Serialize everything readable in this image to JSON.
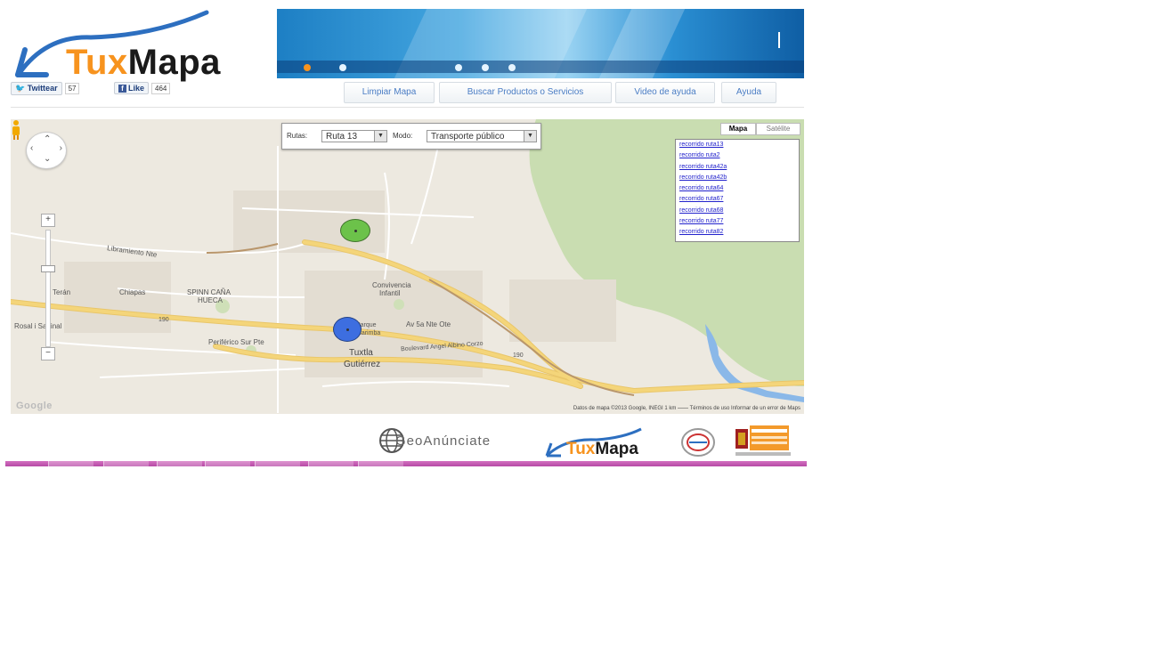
{
  "header": {
    "logo_part1": "Tux",
    "logo_part2": "Mapa",
    "twitter_label": "Twittear",
    "twitter_count": "57",
    "facebook_label": "Like",
    "facebook_count": "464"
  },
  "nav": {
    "items": [
      {
        "label": "Limpiar Mapa"
      },
      {
        "label": "Buscar Productos o Servicios"
      },
      {
        "label": "Video de ayuda"
      },
      {
        "label": "Ayuda"
      }
    ]
  },
  "map": {
    "route_label": "Rutas:",
    "route_value": "Ruta 13",
    "mode_label": "Modo:",
    "mode_value": "Transporte público",
    "maptype": {
      "map": "Mapa",
      "satellite": "Satélite"
    },
    "routes": [
      "recorrido ruta13",
      "recorrido ruta2",
      "recorrido ruta42a",
      "recorrido ruta42b",
      "recorrido ruta64",
      "recorrido ruta67",
      "recorrido ruta68",
      "recorrido ruta77",
      "recorrido ruta82"
    ],
    "places": {
      "city": "Tuxtla",
      "city2": "Gutiérrez",
      "convivencia": "Convivencia",
      "convivencia2": "Infantil",
      "spinn": "SPINN CAÑA",
      "spinn2": "HUECA",
      "libramiento": "Libramiento Nte",
      "chiapas": "Chiapas",
      "av_sur": "Periférico Sur Pte",
      "av_norte": "Av 5a Nte Ote",
      "hwy": "190",
      "hwy2": "190",
      "terán": "Terán",
      "rosal": "Rosal i Sabinal",
      "blvd": "Boulevard Angel Albino Corzo",
      "parque": "Parque",
      "parque2": "Marimba"
    },
    "google": "Google",
    "attribution": "Datos de mapa ©2013 Google, INEGI   1 km ⎯⎯⎯⎯   Términos de uso   Informar de un error de Maps"
  },
  "footer": {
    "geo_label": "GeoAnúnciate",
    "tux_part1": "Tux",
    "tux_part2": "Mapa"
  },
  "colors": {
    "accent_orange": "#f7931e",
    "link_blue": "#4a7dc4",
    "marker_green": "#6cc24a",
    "marker_blue": "#3d6ee0",
    "park_green": "#c9ddb1",
    "road_yellow": "#f4d57a",
    "water": "#8ab8e8"
  },
  "icons": [
    "twitter-bird-icon",
    "facebook-icon",
    "pan-control-icon",
    "pegman-icon",
    "zoom-in-icon",
    "zoom-out-icon",
    "select-arrow-icon"
  ]
}
